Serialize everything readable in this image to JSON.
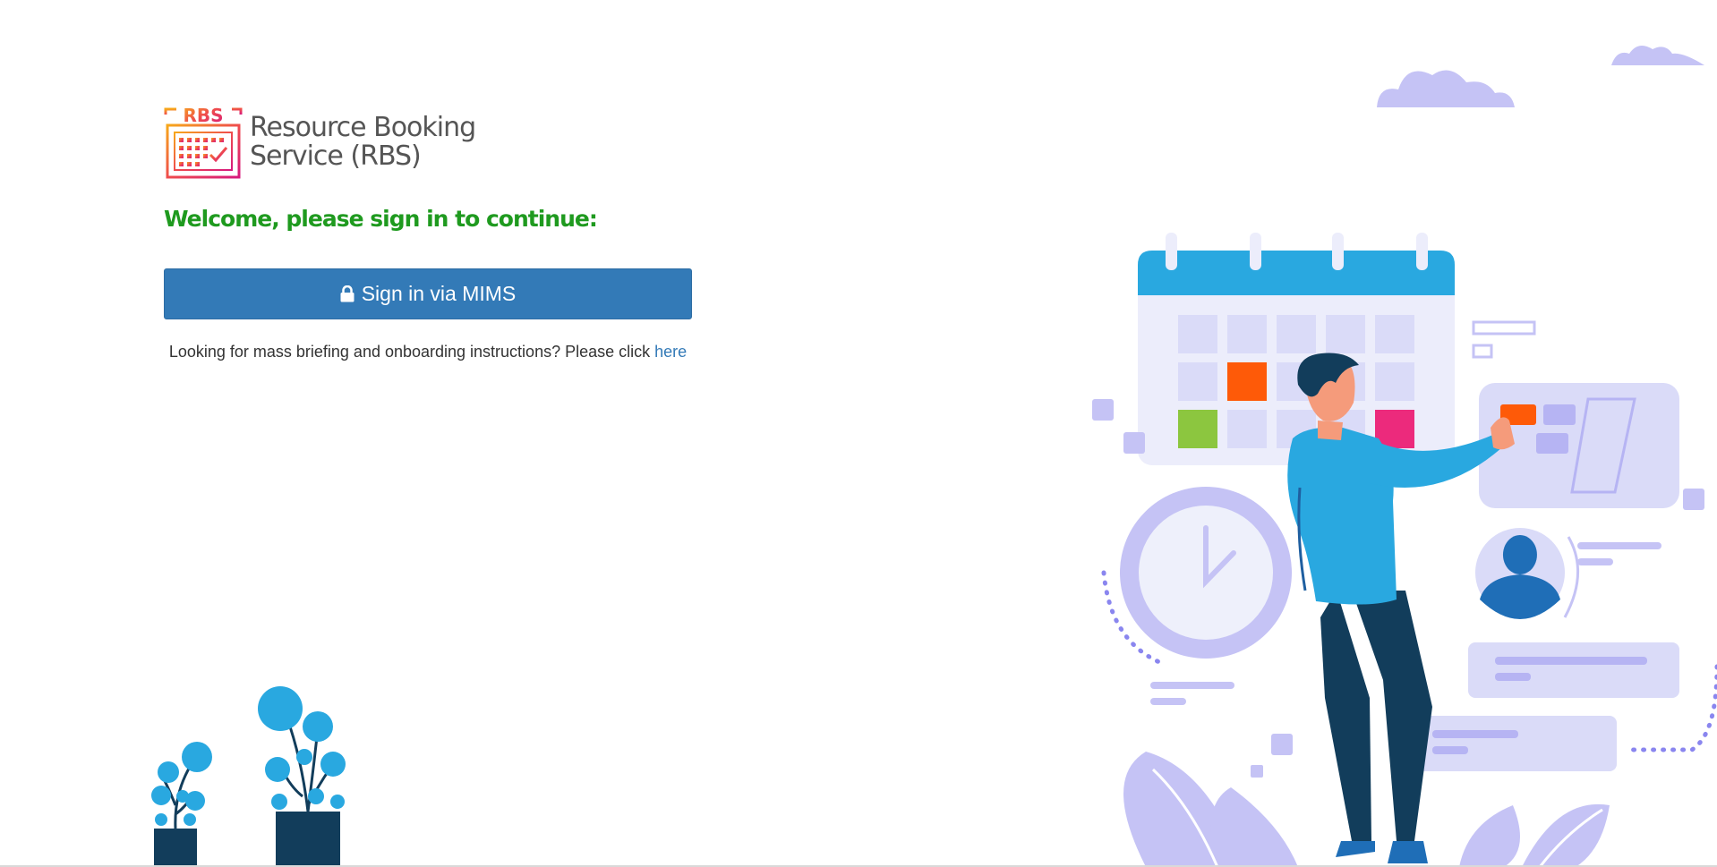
{
  "logo": {
    "badge_text": "RBS",
    "line1": "Resource Booking",
    "line2": "Service (RBS)"
  },
  "welcome_heading": "Welcome, please sign in to continue:",
  "signin_button": {
    "label": "Sign in via MIMS",
    "icon": "lock-icon"
  },
  "onboarding": {
    "text": "Looking for mass briefing and onboarding instructions? Please click ",
    "link_label": "here"
  },
  "colors": {
    "brand_blue": "#337ab7",
    "welcome_green": "#1f9a1f",
    "illustration_blue": "#29a8e0",
    "illustration_lavender": "#c5c3f5"
  }
}
